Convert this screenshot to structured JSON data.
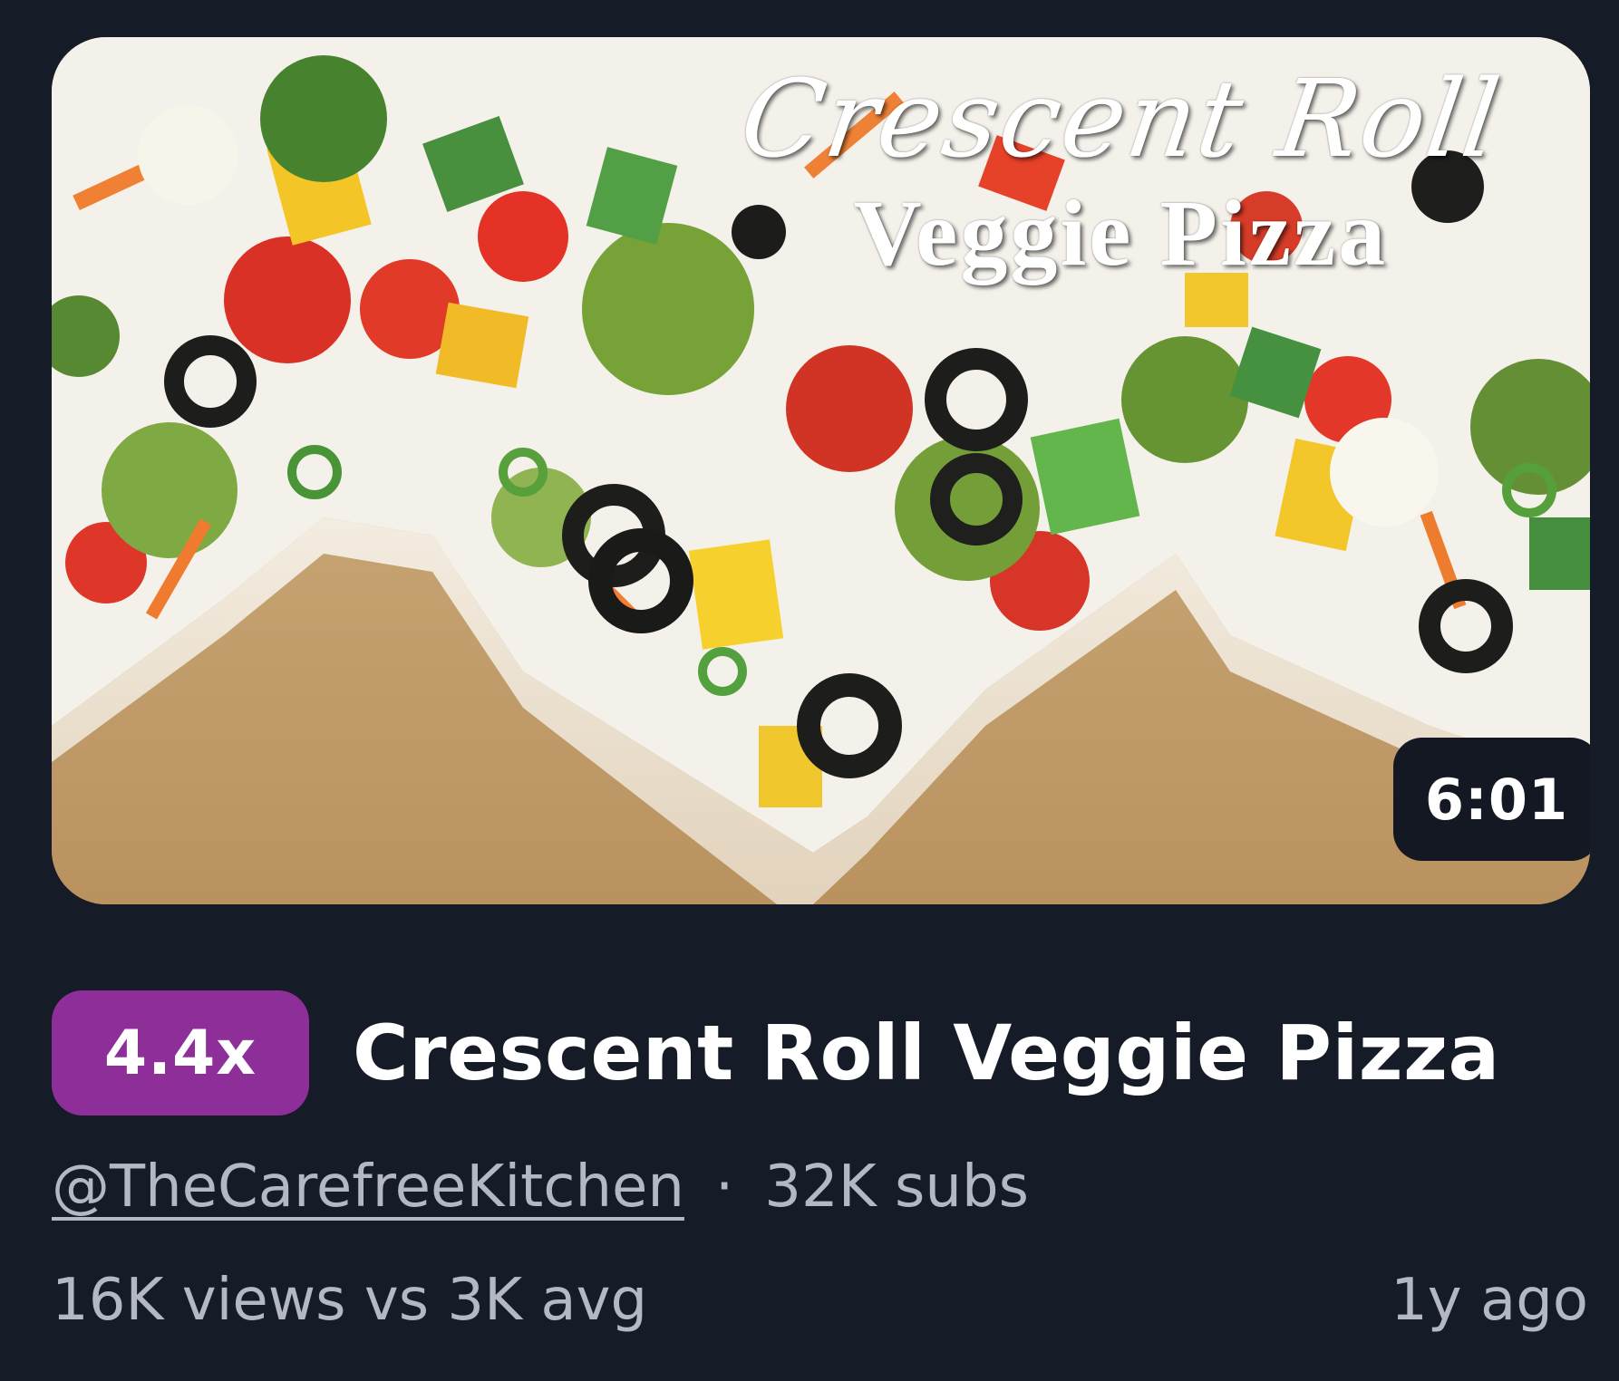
{
  "video": {
    "thumbnail": {
      "overlay_line1": "Crescent Roll",
      "overlay_line2": "Veggie Pizza",
      "duration": "6:01"
    },
    "outlier_badge": "4.4x",
    "title": "Crescent Roll Veggie Pizza",
    "channel": "@TheCarefreeKitchen",
    "separator": "·",
    "subscribers": "32K subs",
    "views_vs_avg": "16K views vs 3K avg",
    "age": "1y ago"
  },
  "colors": {
    "background": "#151b27",
    "badge": "#8e2e99",
    "secondary_text": "#b3b8c3",
    "duration_bg": "#141822"
  }
}
